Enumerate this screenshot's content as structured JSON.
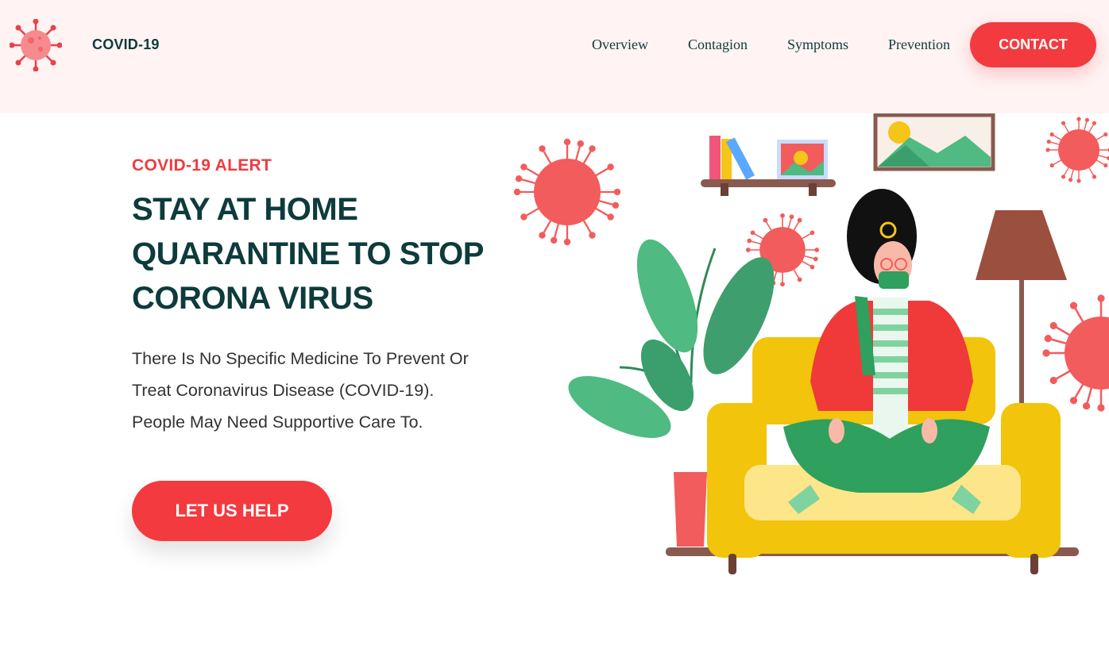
{
  "header": {
    "brand": "COVID-19",
    "logo_icon": "virus-icon",
    "nav": [
      {
        "label": "Overview"
      },
      {
        "label": "Contagion"
      },
      {
        "label": "Symptoms"
      },
      {
        "label": "Prevention"
      }
    ],
    "contact_label": "CONTACT"
  },
  "hero": {
    "alert": "COVID-19 ALERT",
    "headline": [
      "STAY AT HOME",
      "QUARANTINE TO STOP",
      "CORONA VIRUS"
    ],
    "description": [
      "There Is No Specific Medicine To Prevent Or",
      "Treat Coronavirus Disease (COVID-19).",
      "People May Need Supportive Care To."
    ],
    "cta_label": "LET US HELP",
    "illustration": "woman-quarantine-illustration"
  },
  "colors": {
    "accent": "#f23a3f",
    "heading": "#0e3b3b",
    "header_bg": "#fff3f3",
    "virus": "#f25c5c"
  }
}
